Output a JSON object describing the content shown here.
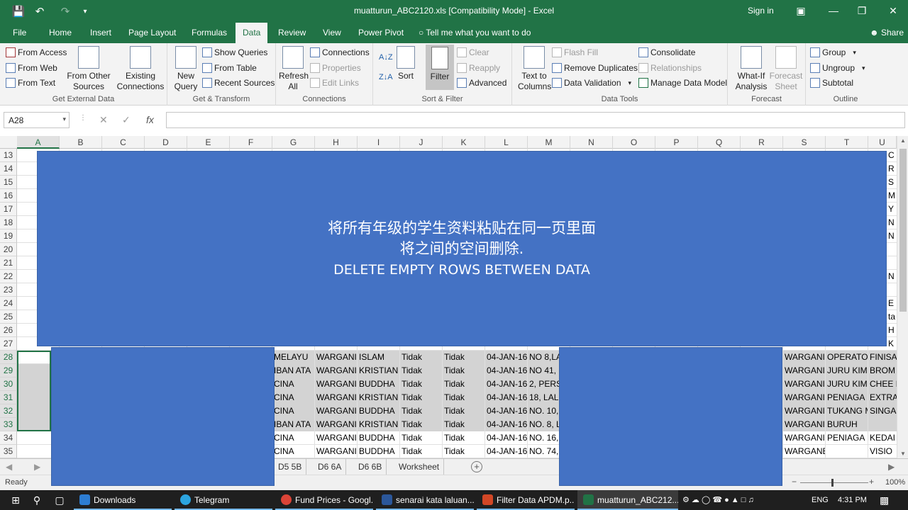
{
  "window": {
    "title": "muatturun_ABC2120.xls  [Compatibility Mode]  -  Excel",
    "signin": "Sign in"
  },
  "tabs": [
    "File",
    "Home",
    "Insert",
    "Page Layout",
    "Formulas",
    "Data",
    "Review",
    "View",
    "Power Pivot"
  ],
  "active_tab": "Data",
  "tellme": "Tell me what you want to do",
  "share": "Share",
  "ribbon": {
    "get_external": {
      "label": "Get External Data",
      "from_access": "From Access",
      "from_web": "From Web",
      "from_text": "From Text",
      "from_other_1": "From Other",
      "from_other_2": "Sources",
      "existing_1": "Existing",
      "existing_2": "Connections"
    },
    "get_transform": {
      "label": "Get & Transform",
      "new_query_1": "New",
      "new_query_2": "Query",
      "show_queries": "Show Queries",
      "from_table": "From Table",
      "recent_sources": "Recent Sources"
    },
    "connections": {
      "label": "Connections",
      "refresh_1": "Refresh",
      "refresh_2": "All",
      "connections": "Connections",
      "properties": "Properties",
      "edit_links": "Edit Links"
    },
    "sort_filter": {
      "label": "Sort & Filter",
      "sort": "Sort",
      "filter": "Filter",
      "clear": "Clear",
      "reapply": "Reapply",
      "advanced": "Advanced"
    },
    "data_tools": {
      "label": "Data Tools",
      "text_to_columns_1": "Text to",
      "text_to_columns_2": "Columns",
      "flash_fill": "Flash Fill",
      "remove_duplicates": "Remove Duplicates",
      "data_validation": "Data Validation",
      "consolidate": "Consolidate",
      "relationships": "Relationships",
      "manage_data_model": "Manage Data Model"
    },
    "forecast": {
      "label": "Forecast",
      "whatif_1": "What-If",
      "whatif_2": "Analysis",
      "forecast_1": "Forecast",
      "forecast_2": "Sheet"
    },
    "outline": {
      "label": "Outline",
      "group": "Group",
      "ungroup": "Ungroup",
      "subtotal": "Subtotal"
    }
  },
  "namebox": "A28",
  "fx": "fx",
  "columns": [
    "A",
    "B",
    "C",
    "D",
    "E",
    "F",
    "G",
    "H",
    "I",
    "J",
    "K",
    "L",
    "M",
    "N",
    "O",
    "P",
    "Q",
    "R",
    "S",
    "T",
    "U"
  ],
  "rows": [
    "13",
    "14",
    "15",
    "16",
    "17",
    "18",
    "19",
    "20",
    "21",
    "22",
    "23",
    "24",
    "25",
    "26",
    "27",
    "28",
    "29",
    "30",
    "31",
    "32",
    "33",
    "34",
    "35"
  ],
  "right_edge_chars": [
    "C",
    "R",
    "S",
    "M",
    "Y K",
    "N",
    "N",
    "",
    "",
    "N",
    "",
    "E",
    "ta",
    "H",
    "K"
  ],
  "data_rows": [
    {
      "row": "28",
      "g": "MELAYU",
      "h": "WARGANI",
      "i": "ISLAM",
      "j": "Tidak",
      "k": "Tidak",
      "l": "04-JAN-16",
      "m": "NO 8,LA",
      "s": "WARGANI",
      "t": "OPERATO",
      "u": "FINISA"
    },
    {
      "row": "29",
      "g": "IBAN ATA",
      "h": "WARGANI",
      "i": "KRISTIAN",
      "j": "Tidak",
      "k": "Tidak",
      "l": "04-JAN-16",
      "m": "NO 41,",
      "s": "WARGANI",
      "t": "JURU KIMI",
      "u": "BROM"
    },
    {
      "row": "30",
      "g": "CINA",
      "h": "WARGANI",
      "i": "BUDDHA",
      "j": "Tidak",
      "k": "Tidak",
      "l": "04-JAN-16",
      "m": "2, PERS",
      "s": "WARGANI",
      "t": "JURU KIMI",
      "u": "CHEE I"
    },
    {
      "row": "31",
      "g": "CINA",
      "h": "WARGANI",
      "i": "KRISTIAN",
      "j": "Tidak",
      "k": "Tidak",
      "l": "04-JAN-16",
      "m": "18, LALU",
      "s": "WARGANI",
      "t": "PENIAGA",
      "u": "EXTRA"
    },
    {
      "row": "32",
      "g": "CINA",
      "h": "WARGANI",
      "i": "BUDDHA",
      "j": "Tidak",
      "k": "Tidak",
      "l": "04-JAN-16",
      "m": "NO. 10,",
      "s": "WARGANI",
      "t": "TUKANG M",
      "u": "SINGA"
    },
    {
      "row": "33",
      "g": "IBAN ATA",
      "h": "WARGANI",
      "i": "KRISTIAN",
      "j": "Tidak",
      "k": "Tidak",
      "l": "04-JAN-16",
      "m": "NO. 8, L",
      "s": "WARGANI",
      "t": "BURUH",
      "u": ""
    },
    {
      "row": "34",
      "g": "CINA",
      "h": "WARGANI",
      "i": "BUDDHA",
      "j": "Tidak",
      "k": "Tidak",
      "l": "04-JAN-16",
      "m": "NO. 16,",
      "s": "WARGANI",
      "t": "PENIAGA",
      "u": "KEDAI"
    },
    {
      "row": "35",
      "g": "CINA",
      "h": "WARGANI",
      "i": "BUDDHA",
      "j": "Tidak",
      "k": "Tidak",
      "l": "04-JAN-16",
      "m": "NO. 74,",
      "s": "WARGANEGARA",
      "t": "",
      "u": "VISIO"
    }
  ],
  "banner": {
    "line1": "将所有年级的学生资料粘贴在同一页里面",
    "line2": "将之间的空间删除.",
    "line3": "DELETE EMPTY ROWS BETWEEN DATA",
    "color": "#4472c4"
  },
  "sheets": [
    "D5 5B",
    "D6 6A",
    "D6 6B",
    "Worksheet"
  ],
  "status": {
    "ready": "Ready",
    "zoom": "100%"
  },
  "taskbar": {
    "apps": [
      "Downloads",
      "Telegram",
      "Fund Prices - Googl...",
      "senarai kata laluan....",
      "Filter Data APDM.p...",
      "muatturun_ABC212..."
    ],
    "lang": "ENG",
    "time": "4:31 PM"
  },
  "colors": {
    "excel_green": "#217346",
    "selection_shade": "#d3d3d3"
  }
}
